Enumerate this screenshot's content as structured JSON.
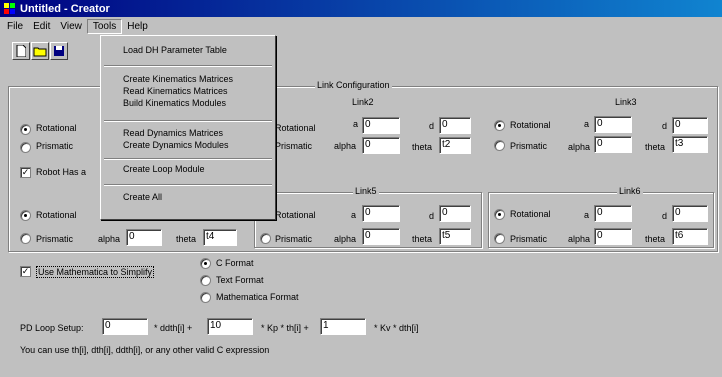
{
  "window": {
    "title": "Untitled - Creator"
  },
  "menu": [
    {
      "label": "File"
    },
    {
      "label": "Edit"
    },
    {
      "label": "View"
    },
    {
      "label": "Tools"
    },
    {
      "label": "Help"
    }
  ],
  "tools_menu": {
    "items": [
      "Load DH Parameter Table",
      "Create Kinematics Matrices",
      "Read Kinematics Matrices",
      "Build Kinematics Modules",
      "Read Dynamics Matrices",
      "Create Dynamics Modules",
      "Create Loop Module",
      "Create All"
    ]
  },
  "link_config": {
    "legend": "Link Configuration",
    "rotational": "Rotational",
    "prismatic": "Prismatic",
    "robot_has": "Robot Has a",
    "links": [
      {
        "name": "Link2",
        "a": "0",
        "d": "0",
        "alpha": "0",
        "theta": "t2"
      },
      {
        "name": "Link3",
        "a": "0",
        "d": "0",
        "alpha": "0",
        "theta": "t3"
      },
      {
        "name": "Link5",
        "a": "0",
        "d": "0",
        "alpha": "0",
        "theta": "t5"
      },
      {
        "name": "Link6",
        "a": "0",
        "d": "0",
        "alpha": "0",
        "theta": "t6"
      }
    ],
    "link4": {
      "alpha": "0",
      "theta": "t4"
    },
    "labels": {
      "a": "a",
      "d": "d",
      "alpha": "alpha",
      "theta": "theta"
    }
  },
  "mathematica": {
    "use_label": "Use Mathematica to Simplify",
    "formats": [
      "C Format",
      "Text Format",
      "Mathematica Format"
    ]
  },
  "pd": {
    "label": "PD Loop Setup:",
    "v1": "0",
    "t1": "* ddth[i] +",
    "v2": "10",
    "t2": "* Kp * th[i] +",
    "v3": "1",
    "t3": "* Kv * dth[i]",
    "hint": "You can use th[i], dth[i], ddth[i], or any other valid C expression"
  }
}
